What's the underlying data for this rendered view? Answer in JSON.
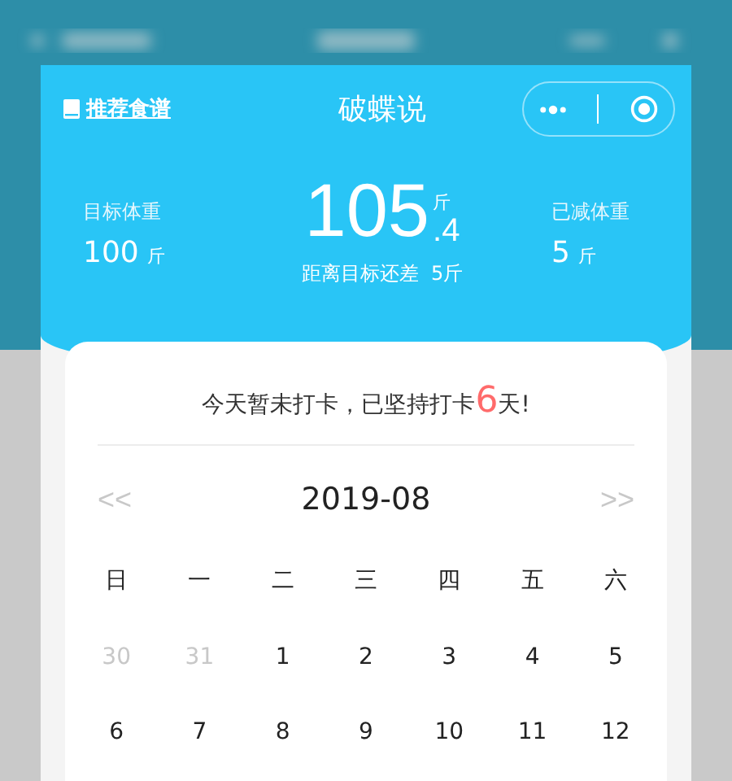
{
  "nav": {
    "link": "推荐食谱",
    "title": "破蝶说"
  },
  "stats": {
    "target_label": "目标体重",
    "target_value": "100",
    "target_unit": "斤",
    "current_int": "105",
    "current_dec": ".4",
    "current_unit": "斤",
    "remaining": "距离目标还差  5斤",
    "lost_label": "已减体重",
    "lost_value": "5",
    "lost_unit": "斤"
  },
  "checkin": {
    "before": "今天暂未打卡，已坚持打卡",
    "days": "6",
    "after": "天!"
  },
  "calendar": {
    "prev": "<<",
    "month": "2019-08",
    "next": ">>",
    "weekdays": [
      "日",
      "一",
      "二",
      "三",
      "四",
      "五",
      "六"
    ],
    "weeks": [
      [
        {
          "day": "30",
          "muted": true
        },
        {
          "day": "31",
          "muted": true
        },
        {
          "day": "1",
          "muted": false
        },
        {
          "day": "2",
          "muted": false
        },
        {
          "day": "3",
          "muted": false
        },
        {
          "day": "4",
          "muted": false
        },
        {
          "day": "5",
          "muted": false
        }
      ],
      [
        {
          "day": "6",
          "muted": false
        },
        {
          "day": "7",
          "muted": false
        },
        {
          "day": "8",
          "muted": false
        },
        {
          "day": "9",
          "muted": false
        },
        {
          "day": "10",
          "muted": false
        },
        {
          "day": "11",
          "muted": false
        },
        {
          "day": "12",
          "muted": false
        }
      ]
    ]
  }
}
